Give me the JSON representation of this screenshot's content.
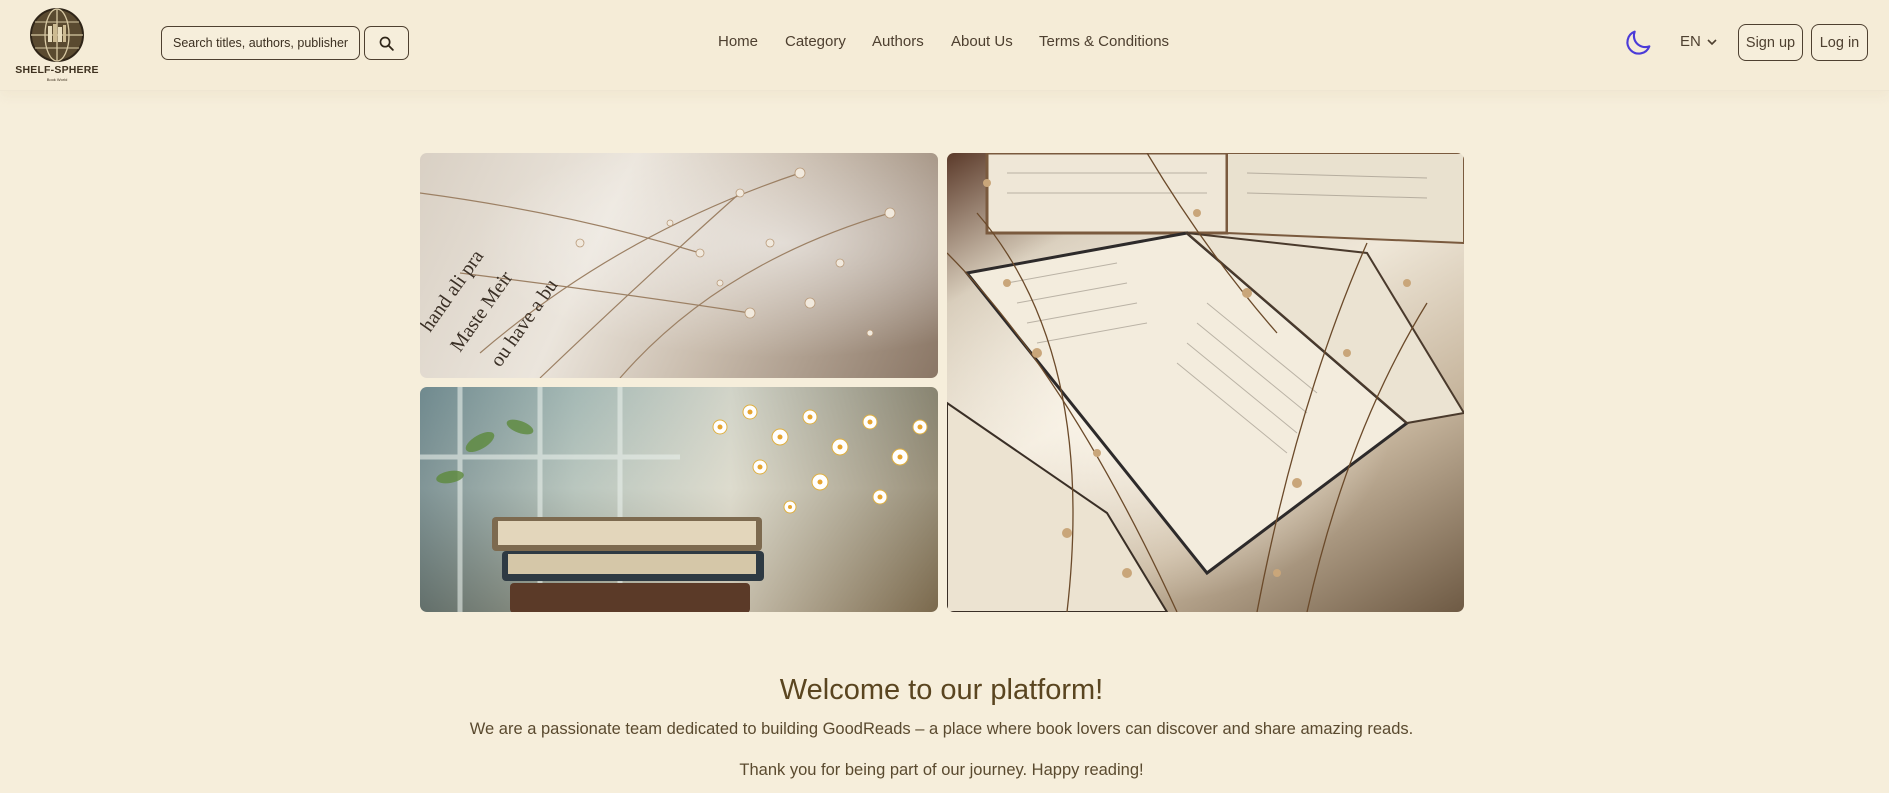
{
  "brand": {
    "name": "SHELF-SPHERE",
    "tagline": "Book World"
  },
  "search": {
    "placeholder": "Search titles, authors, publishers..."
  },
  "nav": {
    "items": [
      {
        "label": "Home"
      },
      {
        "label": "Category"
      },
      {
        "label": "Authors"
      },
      {
        "label": "About Us"
      },
      {
        "label": "Terms & Conditions"
      }
    ]
  },
  "header_actions": {
    "theme_icon": "moon-icon",
    "language": "EN",
    "signup_label": "Sign up",
    "login_label": "Log in"
  },
  "gallery": {
    "images": [
      {
        "name": "open book with dried baby's breath flowers"
      },
      {
        "name": "stack of books with daisies by a window"
      },
      {
        "name": "scattered open books with dried flowers and shadows"
      }
    ]
  },
  "welcome": {
    "title": "Welcome to our platform!",
    "description": "We are a passionate team dedicated to building GoodReads – a place where book lovers can discover and share amazing reads.",
    "thanks": "Thank you for being part of our journey. Happy reading!"
  },
  "colors": {
    "background": "#f6eedb",
    "text": "#5a4a2f",
    "accent_moon": "#4b3bd8",
    "border": "#4e4030"
  }
}
